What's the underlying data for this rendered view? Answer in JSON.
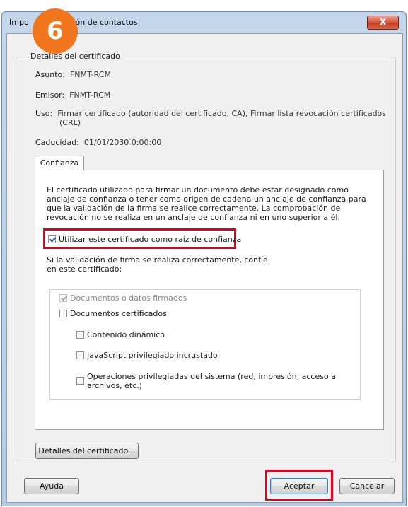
{
  "window": {
    "title_left": "Impo",
    "title_right": "ración de contactos",
    "close_label": "X"
  },
  "step_badge": "6",
  "group": {
    "legend": "Detalles del certificado",
    "subject_label": "Asunto:",
    "subject_value": "FNMT-RCM",
    "issuer_label": "Emisor:",
    "issuer_value": "FNMT-RCM",
    "use_label": "Uso:",
    "use_value_line1": "Firmar certificado (autoridad del certificado, CA), Firmar lista revocación certificados",
    "use_value_line2": "(CRL)",
    "expiry_label": "Caducidad:",
    "expiry_value": "01/01/2030 0:00:00"
  },
  "tab": {
    "label": "Confianza",
    "paragraph": "El certificado utilizado para firmar un documento debe estar designado como anclaje de confianza o tener como origen de cadena un anclaje de confianza para que la validación de la firma se realice correctamente. La comprobación de revocación no se realiza en un anclaje de confianza ni en uno superior a él.",
    "root_checkbox_label": "Utilizar este certificado como raíz de confianza",
    "root_checked": true,
    "trust_paragraph": "Si la validación de firma se realiza correctamente, confíe en este certificado:",
    "options": {
      "signed_docs": "Documentos o datos firmados",
      "certified_docs": "Documentos certificados",
      "dynamic_content": "Contenido dinámico",
      "js_privileged": "JavaScript privilegiado incrustado",
      "system_ops_line1": "Operaciones privilegiadas del sistema (red, impresión, acceso a",
      "system_ops_line2": "archivos, etc.)"
    }
  },
  "buttons": {
    "cert_details": "Detalles del certificado...",
    "help": "Ayuda",
    "accept": "Aceptar",
    "cancel": "Cancelar"
  },
  "colors": {
    "highlight": "#e0001b",
    "badge": "#f2761e"
  }
}
